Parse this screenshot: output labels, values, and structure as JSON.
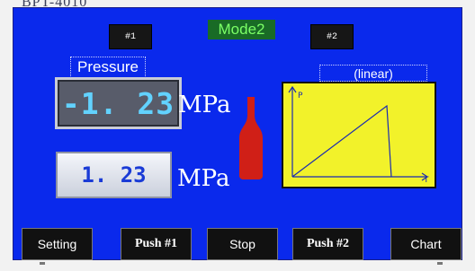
{
  "device_label": "BPT-4010",
  "selectors": {
    "left": "#1",
    "right": "#2"
  },
  "mode_label": "Mode2",
  "pressure": {
    "title": "Pressure",
    "current_value": "-1. 23",
    "set_value": "1. 23",
    "unit": "MPa"
  },
  "chart": {
    "title": "(linear)",
    "y_label": "P",
    "x_label": "T"
  },
  "colors": {
    "screen_bg": "#0a29ec",
    "mode_bg": "#196b26",
    "mode_text": "#7bff66",
    "bottle": "#d01f17",
    "chart_bg": "#f2f22a"
  },
  "buttons": {
    "setting": "Setting",
    "push1": "Push #1",
    "stop": "Stop",
    "push2": "Push #2",
    "chart": "Chart"
  }
}
